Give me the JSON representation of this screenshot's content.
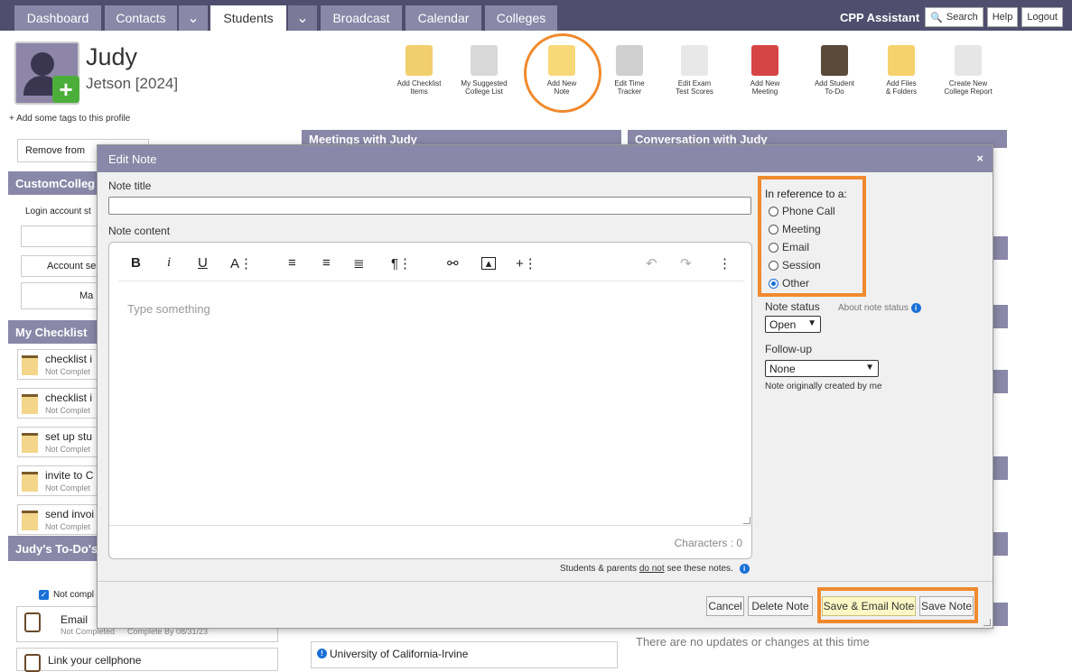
{
  "nav": {
    "tabs": [
      "Dashboard",
      "Contacts",
      "Students",
      "Broadcast",
      "Calendar",
      "Colleges"
    ],
    "assistant": "CPP Assistant",
    "search": "Search",
    "help": "Help",
    "logout": "Logout"
  },
  "profile": {
    "first_name": "Judy",
    "subline": "Jetson [2024]",
    "tags_link": "+ Add some tags to this profile"
  },
  "toolbar": [
    {
      "label1": "Add Checklist",
      "label2": "Items",
      "icon": "checklist-icon",
      "color": "#f2cf6e"
    },
    {
      "label1": "My Suggested",
      "label2": "College List",
      "icon": "college-list-icon",
      "color": "#d8d8d8"
    },
    {
      "label1": "Add New",
      "label2": "Note",
      "icon": "note-icon",
      "color": "#f7d97a"
    },
    {
      "label1": "Edit Time",
      "label2": "Tracker",
      "icon": "stopwatch-icon",
      "color": "#cfcfcf"
    },
    {
      "label1": "Edit Exam",
      "label2": "Test Scores",
      "icon": "pencil-paper-icon",
      "color": "#e8e8e8"
    },
    {
      "label1": "Add New",
      "label2": "Meeting",
      "icon": "calendar-icon",
      "color": "#d64545"
    },
    {
      "label1": "Add Student",
      "label2": "To-Do",
      "icon": "clipboard-icon",
      "color": "#5a4a3a"
    },
    {
      "label1": "Add Files",
      "label2": "& Folders",
      "icon": "folder-icon",
      "color": "#f5d26b"
    },
    {
      "label1": "Create New",
      "label2": "College Report",
      "icon": "report-icon",
      "color": "#e6e6e6"
    }
  ],
  "background": {
    "remove_btn": "Remove from",
    "custom_college": "CustomColleg",
    "login_status": "Login account st",
    "account_settings": "Account se",
    "ma": "Ma",
    "my_checklist": "My Checklist",
    "meetings_head": "Meetings with Judy",
    "conversation_head": "Conversation with Judy",
    "checklist": [
      {
        "title": "checklist i",
        "status": "Not Complet"
      },
      {
        "title": "checklist i",
        "status": "Not Complet"
      },
      {
        "title": "set up stu",
        "status": "Not Complet"
      },
      {
        "title": "invite to C",
        "status": "Not Complet"
      },
      {
        "title": "send invoi",
        "status": "Not Complet"
      }
    ],
    "todos_head": "Judy's To-Do's",
    "not_complete": "Not compl",
    "todo1_title": "Email",
    "todo1_status": "Not Completed",
    "todo1_due": "Complete By 08/31/23",
    "todo2_title": "Link your cellphone",
    "college_item": "University of California-Irvine",
    "no_updates": "There are no updates or changes at this time"
  },
  "modal": {
    "title": "Edit Note",
    "close": "×",
    "note_title_label": "Note title",
    "note_title_value": "",
    "note_content_label": "Note content",
    "placeholder": "Type something",
    "characters": "Characters : 0",
    "privacy_prefix": "Students & parents ",
    "privacy_do_not": "do not",
    "privacy_suffix": " see these notes.",
    "reference_label": "In reference to a:",
    "reference_options": [
      {
        "label": "Phone Call",
        "selected": false
      },
      {
        "label": "Meeting",
        "selected": false
      },
      {
        "label": "Email",
        "selected": false
      },
      {
        "label": "Session",
        "selected": false
      },
      {
        "label": "Other",
        "selected": true
      }
    ],
    "note_status_label": "Note status",
    "about_status": "About note status",
    "status_value": "Open",
    "followup_label": "Follow-up",
    "followup_value": "None",
    "created_by": "Note originally created by me",
    "buttons": {
      "cancel": "Cancel",
      "delete": "Delete Note",
      "save_email": "Save & Email Note",
      "save": "Save Note"
    }
  },
  "colors": {
    "nav_bg": "#4f4e6e",
    "tab_bg": "#8a88a8",
    "highlight": "#f08a2e",
    "save_email_bg": "#fbf8c5"
  }
}
